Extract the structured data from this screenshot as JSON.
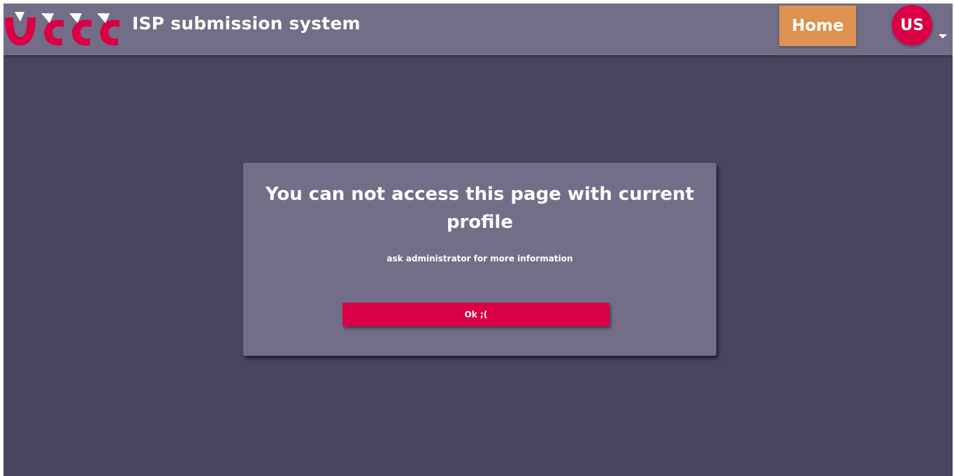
{
  "header": {
    "app_title": "ISP submission system",
    "home_label": "Home",
    "avatar_initials": "US"
  },
  "dialog": {
    "title": "You can not access this page with current profile",
    "subtitle": "ask administrator for more information",
    "ok_label": "Ok ;("
  },
  "colors": {
    "page_background": "#4a455e",
    "header_background": "#736e88",
    "dialog_background": "#736e88",
    "accent_red": "#d90046",
    "home_button": "#dc9250",
    "text": "#ffffff"
  },
  "icons": {
    "logo": "uccc-logo",
    "avatar_menu": "caret-down-icon"
  }
}
